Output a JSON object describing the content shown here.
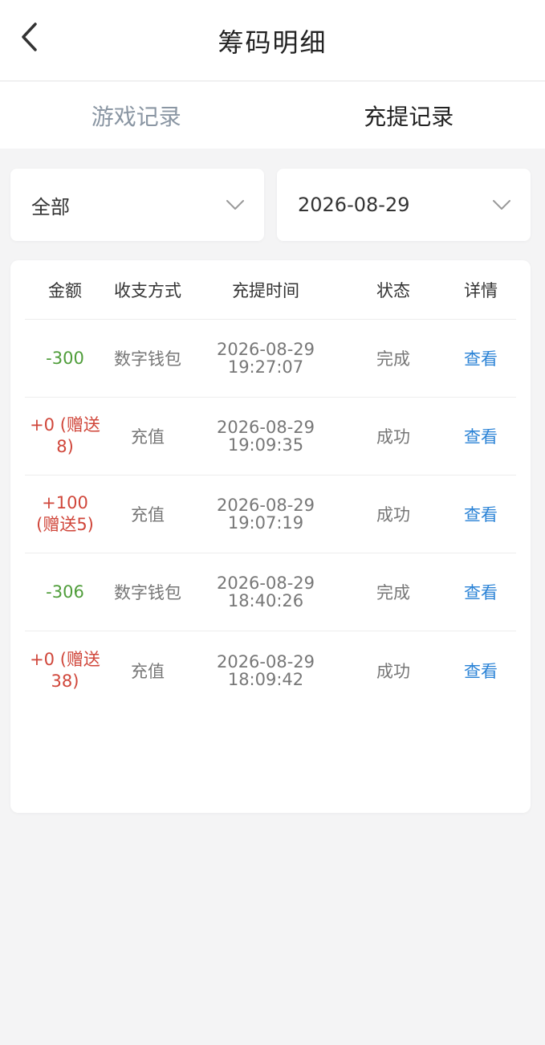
{
  "header": {
    "title": "筹码明细"
  },
  "tabs": [
    {
      "label": "游戏记录",
      "active": false
    },
    {
      "label": "充提记录",
      "active": true
    }
  ],
  "filters": {
    "category": "全部",
    "date": "2026-08-29"
  },
  "table": {
    "headers": [
      "金额",
      "收支方式",
      "充提时间",
      "状态",
      "详情"
    ],
    "rows": [
      {
        "amount": "-300",
        "method": "数字钱包",
        "date": "2026-08-29",
        "time": "19:27:07",
        "status": "完成",
        "action": "查看"
      },
      {
        "amount": "+0 (赠送8)",
        "method": "充值",
        "date": "2026-08-29",
        "time": "19:09:35",
        "status": "成功",
        "action": "查看"
      },
      {
        "amount": "+100 (赠送5)",
        "method": "充值",
        "date": "2026-08-29",
        "time": "19:07:19",
        "status": "成功",
        "action": "查看"
      },
      {
        "amount": "-306",
        "method": "数字钱包",
        "date": "2026-08-29",
        "time": "18:40:26",
        "status": "完成",
        "action": "查看"
      },
      {
        "amount": "+0 (赠送38)",
        "method": "充值",
        "date": "2026-08-29",
        "time": "18:09:42",
        "status": "成功",
        "action": "查看"
      }
    ]
  },
  "colors": {
    "negative": "#4f9d3a",
    "positive": "#d0463a",
    "link": "#2b83d6"
  }
}
